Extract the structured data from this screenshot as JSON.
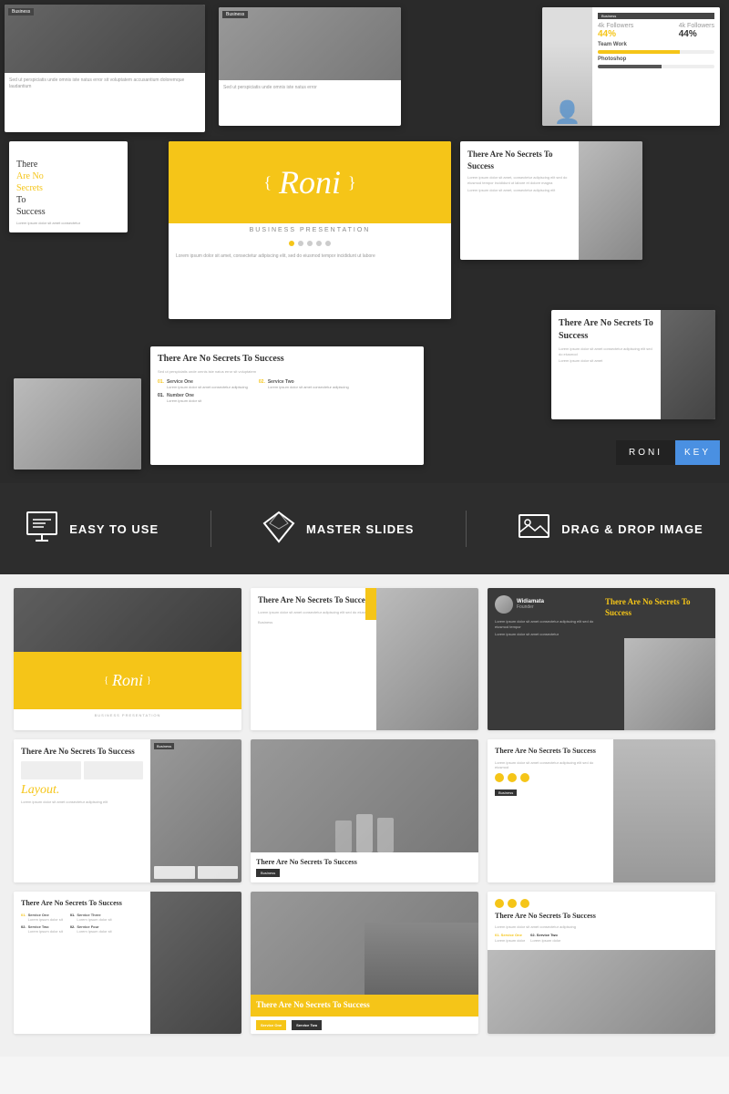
{
  "top": {
    "slides": {
      "main_title": "Roni",
      "main_subtitle": "BUSINESS PRESENTATION",
      "tagline": "There Are No Secrets To Success"
    }
  },
  "features": [
    {
      "id": "easy-to-use",
      "icon": "🖥",
      "label": "EASY TO USE"
    },
    {
      "id": "master-slides",
      "icon": "◈",
      "label": "MASTER SLIDES"
    },
    {
      "id": "drag-drop",
      "icon": "🖼",
      "label": "DRAG & DROP IMAGE"
    }
  ],
  "roni_key": {
    "name": "RONI",
    "badge": "KEY"
  },
  "grid": {
    "rows": [
      [
        {
          "id": "g1",
          "type": "roni-title"
        },
        {
          "id": "g2",
          "type": "building-slide",
          "title": "There Are No Secrets To Success"
        },
        {
          "id": "g3",
          "type": "person-dark",
          "title": "There Are No Secrets To Success",
          "subtitle": "Widiamata\nFounder"
        }
      ],
      [
        {
          "id": "g4",
          "type": "secrets-left",
          "title": "There Are No Secrets To Success"
        },
        {
          "id": "g5",
          "type": "team-photo",
          "title": "There Are No Secrets To Success"
        },
        {
          "id": "g6",
          "type": "person-right",
          "title": "There Are No Secrets To Success"
        }
      ],
      [
        {
          "id": "g7",
          "type": "services",
          "title": "There Are No Secrets To Success"
        },
        {
          "id": "g8",
          "type": "city-secrets",
          "title": "There Are No\nSecrets To\nSuccess"
        },
        {
          "id": "g9",
          "type": "circles-secrets",
          "title": "There Are No Secrets To Success"
        }
      ]
    ]
  }
}
